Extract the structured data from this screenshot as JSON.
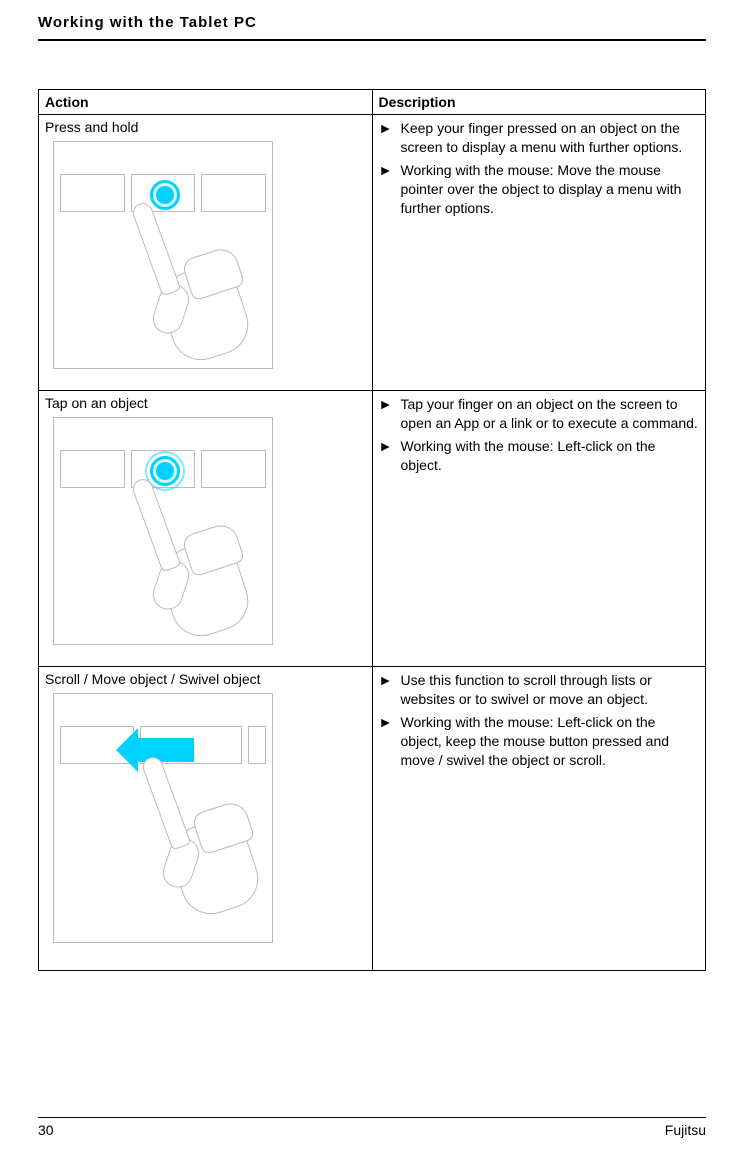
{
  "header": {
    "title": "Working with the Tablet PC"
  },
  "table": {
    "headers": {
      "action": "Action",
      "description": "Description"
    },
    "rows": [
      {
        "action_label": "Press and hold",
        "descriptions": [
          "Keep your finger pressed on an object on the screen to display a menu with further options.",
          "Working with the mouse: Move the mouse pointer over the object to display a menu with further options."
        ]
      },
      {
        "action_label": "Tap on an object",
        "descriptions": [
          "Tap your finger on an object on the screen to open an App or a link or to execute a command.",
          "Working with the mouse: Left-click on the object."
        ]
      },
      {
        "action_label": "Scroll / Move object / Swivel object",
        "descriptions": [
          "Use this function to scroll through lists or websites or to swivel or move an object.",
          "Working with the mouse: Left-click on the object, keep the mouse button pressed and move / swivel the object or scroll."
        ]
      }
    ]
  },
  "footer": {
    "page_number": "30",
    "brand": "Fujitsu"
  }
}
